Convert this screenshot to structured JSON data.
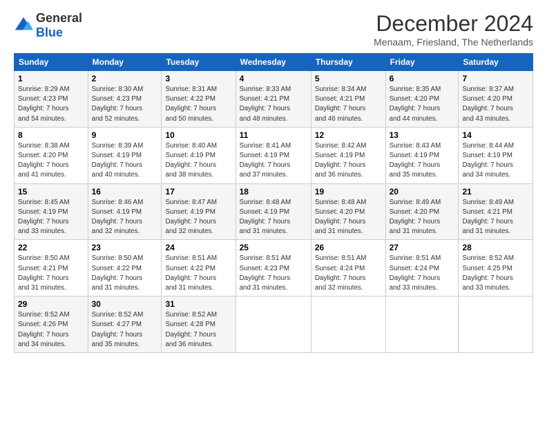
{
  "logo": {
    "general": "General",
    "blue": "Blue"
  },
  "title": {
    "month_year": "December 2024",
    "location": "Menaam, Friesland, The Netherlands"
  },
  "headers": [
    "Sunday",
    "Monday",
    "Tuesday",
    "Wednesday",
    "Thursday",
    "Friday",
    "Saturday"
  ],
  "weeks": [
    [
      {
        "day": "1",
        "sunrise": "8:29 AM",
        "sunset": "4:23 PM",
        "daylight": "7 hours and 54 minutes."
      },
      {
        "day": "2",
        "sunrise": "8:30 AM",
        "sunset": "4:23 PM",
        "daylight": "7 hours and 52 minutes."
      },
      {
        "day": "3",
        "sunrise": "8:31 AM",
        "sunset": "4:22 PM",
        "daylight": "7 hours and 50 minutes."
      },
      {
        "day": "4",
        "sunrise": "8:33 AM",
        "sunset": "4:21 PM",
        "daylight": "7 hours and 48 minutes."
      },
      {
        "day": "5",
        "sunrise": "8:34 AM",
        "sunset": "4:21 PM",
        "daylight": "7 hours and 46 minutes."
      },
      {
        "day": "6",
        "sunrise": "8:35 AM",
        "sunset": "4:20 PM",
        "daylight": "7 hours and 44 minutes."
      },
      {
        "day": "7",
        "sunrise": "8:37 AM",
        "sunset": "4:20 PM",
        "daylight": "7 hours and 43 minutes."
      }
    ],
    [
      {
        "day": "8",
        "sunrise": "8:38 AM",
        "sunset": "4:20 PM",
        "daylight": "7 hours and 41 minutes."
      },
      {
        "day": "9",
        "sunrise": "8:39 AM",
        "sunset": "4:19 PM",
        "daylight": "7 hours and 40 minutes."
      },
      {
        "day": "10",
        "sunrise": "8:40 AM",
        "sunset": "4:19 PM",
        "daylight": "7 hours and 38 minutes."
      },
      {
        "day": "11",
        "sunrise": "8:41 AM",
        "sunset": "4:19 PM",
        "daylight": "7 hours and 37 minutes."
      },
      {
        "day": "12",
        "sunrise": "8:42 AM",
        "sunset": "4:19 PM",
        "daylight": "7 hours and 36 minutes."
      },
      {
        "day": "13",
        "sunrise": "8:43 AM",
        "sunset": "4:19 PM",
        "daylight": "7 hours and 35 minutes."
      },
      {
        "day": "14",
        "sunrise": "8:44 AM",
        "sunset": "4:19 PM",
        "daylight": "7 hours and 34 minutes."
      }
    ],
    [
      {
        "day": "15",
        "sunrise": "8:45 AM",
        "sunset": "4:19 PM",
        "daylight": "7 hours and 33 minutes."
      },
      {
        "day": "16",
        "sunrise": "8:46 AM",
        "sunset": "4:19 PM",
        "daylight": "7 hours and 32 minutes."
      },
      {
        "day": "17",
        "sunrise": "8:47 AM",
        "sunset": "4:19 PM",
        "daylight": "7 hours and 32 minutes."
      },
      {
        "day": "18",
        "sunrise": "8:48 AM",
        "sunset": "4:19 PM",
        "daylight": "7 hours and 31 minutes."
      },
      {
        "day": "19",
        "sunrise": "8:48 AM",
        "sunset": "4:20 PM",
        "daylight": "7 hours and 31 minutes."
      },
      {
        "day": "20",
        "sunrise": "8:49 AM",
        "sunset": "4:20 PM",
        "daylight": "7 hours and 31 minutes."
      },
      {
        "day": "21",
        "sunrise": "8:49 AM",
        "sunset": "4:21 PM",
        "daylight": "7 hours and 31 minutes."
      }
    ],
    [
      {
        "day": "22",
        "sunrise": "8:50 AM",
        "sunset": "4:21 PM",
        "daylight": "7 hours and 31 minutes."
      },
      {
        "day": "23",
        "sunrise": "8:50 AM",
        "sunset": "4:22 PM",
        "daylight": "7 hours and 31 minutes."
      },
      {
        "day": "24",
        "sunrise": "8:51 AM",
        "sunset": "4:22 PM",
        "daylight": "7 hours and 31 minutes."
      },
      {
        "day": "25",
        "sunrise": "8:51 AM",
        "sunset": "4:23 PM",
        "daylight": "7 hours and 31 minutes."
      },
      {
        "day": "26",
        "sunrise": "8:51 AM",
        "sunset": "4:24 PM",
        "daylight": "7 hours and 32 minutes."
      },
      {
        "day": "27",
        "sunrise": "8:51 AM",
        "sunset": "4:24 PM",
        "daylight": "7 hours and 33 minutes."
      },
      {
        "day": "28",
        "sunrise": "8:52 AM",
        "sunset": "4:25 PM",
        "daylight": "7 hours and 33 minutes."
      }
    ],
    [
      {
        "day": "29",
        "sunrise": "8:52 AM",
        "sunset": "4:26 PM",
        "daylight": "7 hours and 34 minutes."
      },
      {
        "day": "30",
        "sunrise": "8:52 AM",
        "sunset": "4:27 PM",
        "daylight": "7 hours and 35 minutes."
      },
      {
        "day": "31",
        "sunrise": "8:52 AM",
        "sunset": "4:28 PM",
        "daylight": "7 hours and 36 minutes."
      },
      null,
      null,
      null,
      null
    ]
  ],
  "labels": {
    "sunrise": "Sunrise: ",
    "sunset": "Sunset: ",
    "daylight": "Daylight: "
  }
}
